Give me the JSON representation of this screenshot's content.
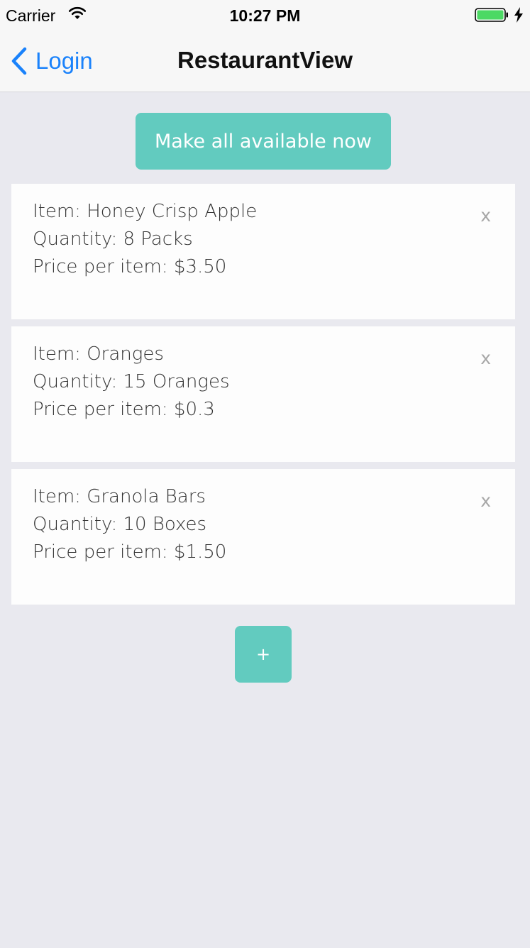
{
  "status_bar": {
    "carrier": "Carrier",
    "time": "10:27 PM",
    "battery_color": "#4cd964"
  },
  "nav": {
    "back_label": "Login",
    "title": "RestaurantView",
    "accent_color": "#1a82fb"
  },
  "main": {
    "make_available_label": "Make all available now",
    "add_label": "+",
    "button_color": "#62cbbf",
    "items": [
      {
        "item": "Item: Honey Crisp Apple",
        "quantity": "Quantity: 8 Packs",
        "price": "Price per item: $3.50",
        "close": "x"
      },
      {
        "item": "Item: Oranges",
        "quantity": "Quantity: 15 Oranges",
        "price": "Price per item: $0.3",
        "close": "x"
      },
      {
        "item": "Item: Granola Bars",
        "quantity": "Quantity: 10 Boxes",
        "price": "Price per item: $1.50",
        "close": "x"
      }
    ]
  }
}
